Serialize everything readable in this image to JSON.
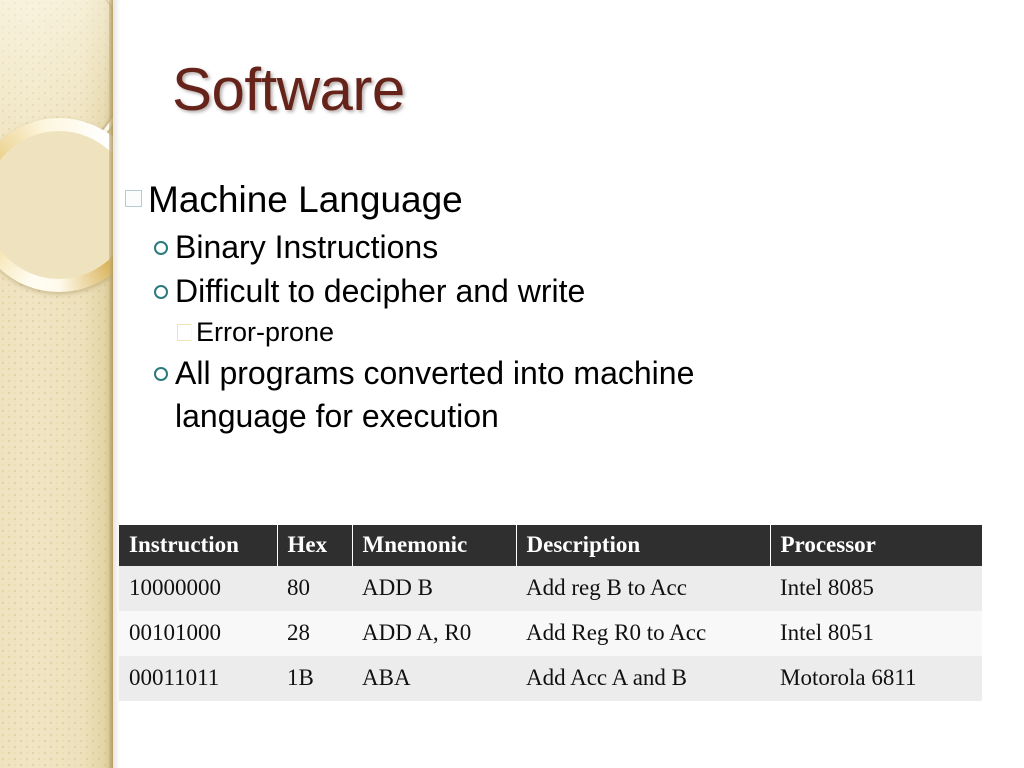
{
  "slide": {
    "title": "Software",
    "title_color": "#66231a",
    "background_color": "#ffffff"
  },
  "sidebar": {
    "base_color": "#efe3bf",
    "edge_color": "#b09860",
    "ring_accent_color": "#e3c068"
  },
  "content": {
    "bullets": [
      {
        "level": 1,
        "bullet_glyph": "square-box-bullet",
        "bullet_color": "#b4ccd3",
        "text": "Machine Language"
      },
      {
        "level": 2,
        "bullet_glyph": "hollow-circle-bullet",
        "bullet_color": "#2b7a7e",
        "text": "Binary Instructions"
      },
      {
        "level": 2,
        "bullet_glyph": "hollow-circle-bullet",
        "bullet_color": "#2b7a7e",
        "text": "Difficult to decipher and write"
      },
      {
        "level": 3,
        "bullet_glyph": "square-box-bullet",
        "bullet_color": "#f2e3b6",
        "text": "Error-prone"
      },
      {
        "level": 2,
        "bullet_glyph": "hollow-circle-bullet",
        "bullet_color": "#2b7a7e",
        "text": "All programs converted into machine\nlanguage for execution"
      }
    ]
  },
  "table": {
    "header_bg": "#2f2f2f",
    "header_text_color": "#ffffff",
    "row_bg_odd": "#ececec",
    "row_bg_even": "#f8f8f8",
    "columns": [
      "Instruction",
      "Hex",
      "Mnemonic",
      "Description",
      "Processor"
    ],
    "rows": [
      [
        "10000000",
        "80",
        "ADD B",
        "Add reg B to Acc",
        "Intel 8085"
      ],
      [
        "00101000",
        "28",
        "ADD A, R0",
        "Add Reg R0 to Acc",
        "Intel 8051"
      ],
      [
        "00011011",
        "1B",
        "ABA",
        "Add Acc A and B",
        "Motorola 6811"
      ]
    ]
  }
}
